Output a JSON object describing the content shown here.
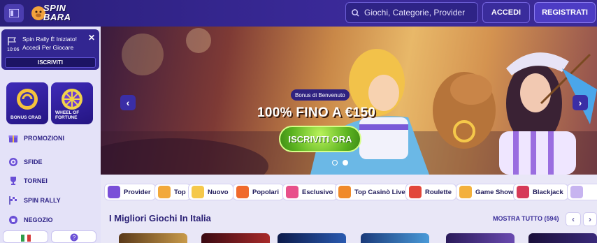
{
  "header": {
    "logo_text_line1": "SPIN",
    "logo_text_line2": "BARA",
    "search_placeholder": "Giochi, Categorie, Provider",
    "login_label": "ACCEDI",
    "register_label": "REGISTRATI"
  },
  "sidebar": {
    "notice": {
      "time": "10:06",
      "message": "Spin Rally È Iniziato! Accedi Per Giocare",
      "button_label": "ISCRIVITI"
    },
    "tiles": [
      {
        "label": "BONUS CRAB",
        "icon": "crab-coin-icon"
      },
      {
        "label": "WHEEL OF FORTUNE",
        "icon": "wheel-icon"
      }
    ],
    "nav": [
      {
        "label": "PROMOZIONI",
        "icon": "gift-icon"
      },
      {
        "label": "SFIDE",
        "icon": "target-icon"
      },
      {
        "label": "TORNEI",
        "icon": "trophy-icon"
      },
      {
        "label": "SPIN RALLY",
        "icon": "flag-icon"
      },
      {
        "label": "NEGOZIO",
        "icon": "shop-icon"
      }
    ]
  },
  "banner": {
    "tag": "Bonus di Benvenuto",
    "headline": "100% FINO A €150",
    "cta_label": "ISCRIVITI ORA",
    "slides_total": 3,
    "active_slide": 2
  },
  "categories": [
    {
      "label": "Provider",
      "icon": "provider-icon",
      "color": "#7a4fd8"
    },
    {
      "label": "Top",
      "icon": "crown-icon",
      "color": "#f2a93b"
    },
    {
      "label": "Nuovo",
      "icon": "sparkle-icon",
      "color": "#f5c84a"
    },
    {
      "label": "Popolari",
      "icon": "fire-icon",
      "color": "#f06a2c"
    },
    {
      "label": "Esclusivo",
      "icon": "diamond-icon",
      "color": "#e8508a"
    },
    {
      "label": "Top Casinò Live",
      "icon": "star-icon",
      "color": "#f08a2a"
    },
    {
      "label": "Roulette",
      "icon": "roulette-icon",
      "color": "#e2473a"
    },
    {
      "label": "Game Show",
      "icon": "microphone-icon",
      "color": "#f3b03c"
    },
    {
      "label": "Blackjack",
      "icon": "cards-icon",
      "color": "#d63a58"
    }
  ],
  "section": {
    "title": "I Migliori Giochi In Italia",
    "show_all": "MOSTRA TUTTO (594)"
  },
  "colors": {
    "header_bg": "#2a1f7a",
    "accent": "#4d3cc4",
    "cta_green": "#5bb320"
  }
}
